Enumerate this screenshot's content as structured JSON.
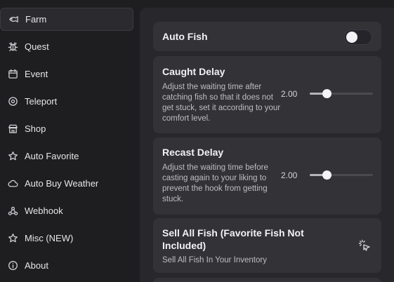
{
  "sidebar": {
    "items": [
      {
        "label": "Farm",
        "icon": "fish-icon",
        "active": true
      },
      {
        "label": "Quest",
        "icon": "bug-icon"
      },
      {
        "label": "Event",
        "icon": "calendar-icon"
      },
      {
        "label": "Teleport",
        "icon": "teleport-icon"
      },
      {
        "label": "Shop",
        "icon": "store-icon"
      },
      {
        "label": "Auto Favorite",
        "icon": "star-icon"
      },
      {
        "label": "Auto Buy Weather",
        "icon": "cloud-icon"
      },
      {
        "label": "Webhook",
        "icon": "webhook-icon"
      },
      {
        "label": "Misc (NEW)",
        "icon": "star-icon"
      },
      {
        "label": "About",
        "icon": "info-icon"
      }
    ]
  },
  "main": {
    "auto_fish": {
      "title": "Auto Fish",
      "enabled": false
    },
    "caught_delay": {
      "title": "Caught Delay",
      "description": "Adjust the waiting time after catching fish so that it does not get stuck, set it according to your comfort level.",
      "value": "2.00",
      "fraction": 0.27
    },
    "recast_delay": {
      "title": "Recast Delay",
      "description": "Adjust the waiting time before casting again to your liking to prevent the hook from getting stuck.",
      "value": "2.00",
      "fraction": 0.27
    },
    "sell_all": {
      "title": "Sell All Fish (Favorite Fish Not Included)",
      "description": "Sell All Fish In Your Inventory",
      "icon": "pointer-click-icon"
    }
  }
}
